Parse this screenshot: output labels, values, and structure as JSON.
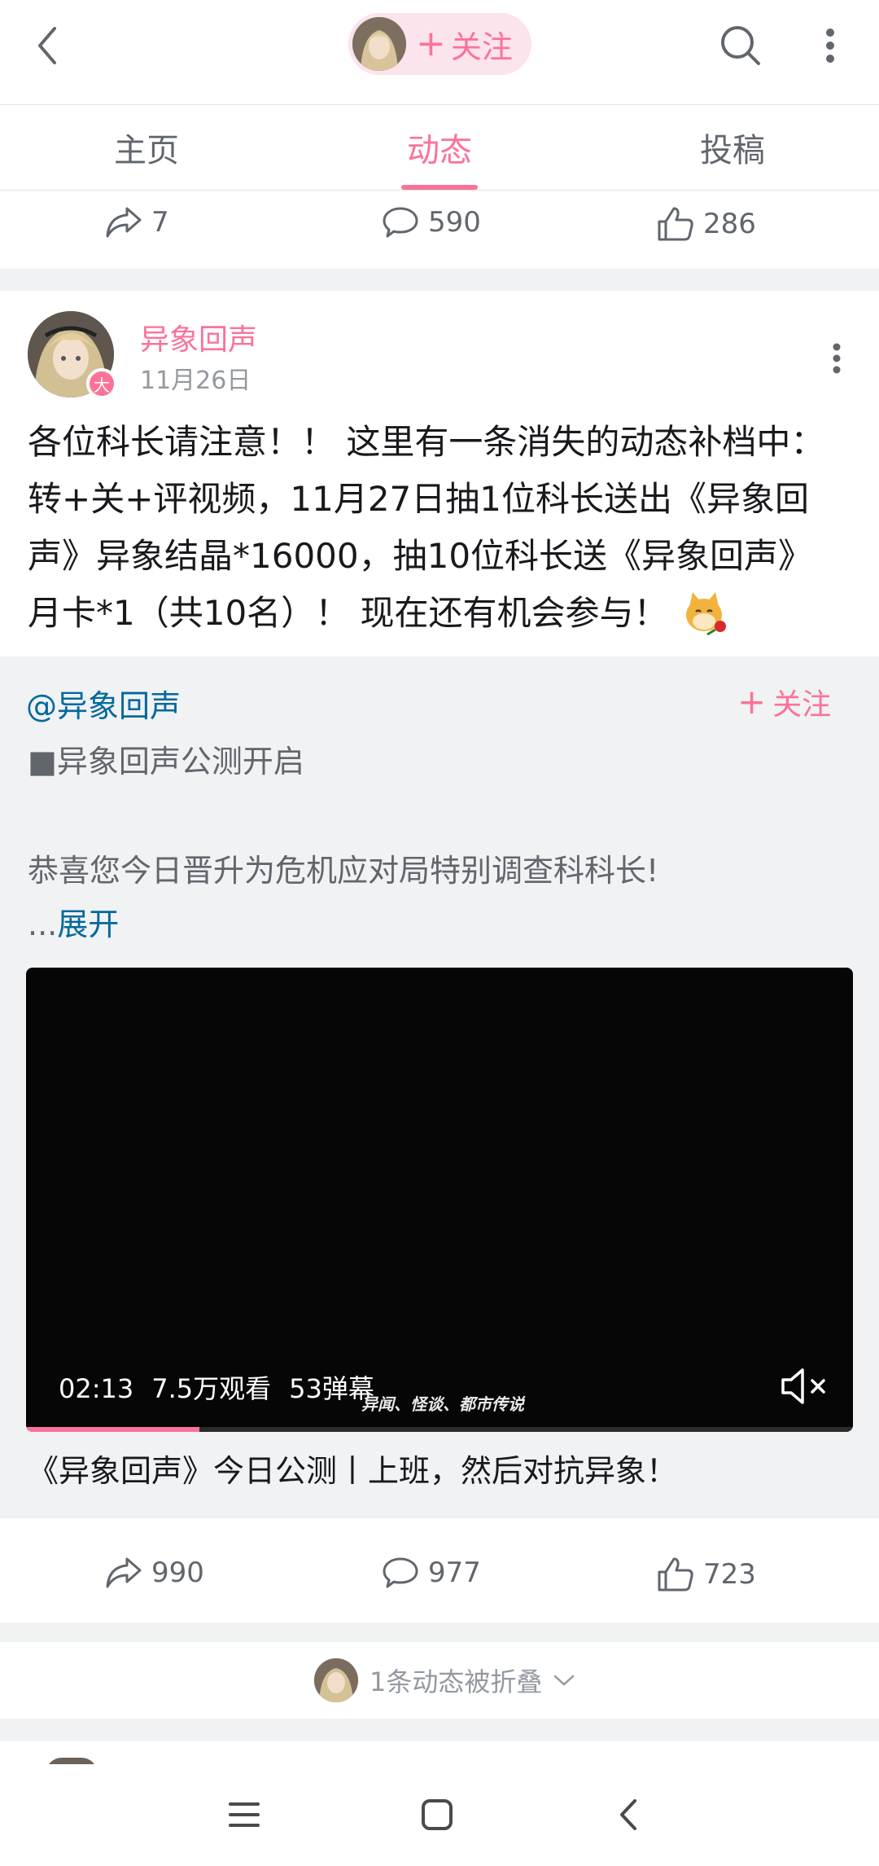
{
  "header": {
    "follow_label": "关注",
    "icons": {
      "back": "back-arrow-icon",
      "search": "search-icon",
      "more": "more-vertical-icon"
    }
  },
  "tabs": [
    {
      "label": "主页",
      "active": false
    },
    {
      "label": "动态",
      "active": true
    },
    {
      "label": "投稿",
      "active": false
    }
  ],
  "prev_post_actions": {
    "shares": "7",
    "comments": "590",
    "likes": "286"
  },
  "post": {
    "author": "异象回声",
    "date": "11月26日",
    "badge": "大",
    "text_lines": [
      "各位科长请注意！！ 这里有一条消失的动态补档中：",
      "转+关+评视频，11月27日抽1位科长送出《异象回",
      "声》异象结晶*16000，抽10位科长送《异象回声》",
      "月卡*1（共10名）！ 现在还有机会参与！"
    ],
    "emoji": "doge-rose-emoji"
  },
  "repost": {
    "user": "@异象回声",
    "follow_label": "关注",
    "line1": "■异象回声公测开启",
    "line2": "恭喜您今日晋升为危机应对局特别调查科科长!",
    "ellipsis": "...",
    "expand_label": "展开",
    "video": {
      "duration": "02:13",
      "views": "7.5万观看",
      "danmaku": "53弹幕",
      "caption": "异闻、怪谈、都市传说",
      "progress": 0.21,
      "muted": true
    },
    "video_title": "《异象回声》今日公测丨上班，然后对抗异象！"
  },
  "post_actions": {
    "shares": "990",
    "comments": "977",
    "likes": "723"
  },
  "folded": {
    "label": "1条动态被折叠"
  },
  "colors": {
    "accent": "#fb7299",
    "link": "#00699d",
    "muted": "#61666d",
    "divider": "#f1f2f3"
  }
}
